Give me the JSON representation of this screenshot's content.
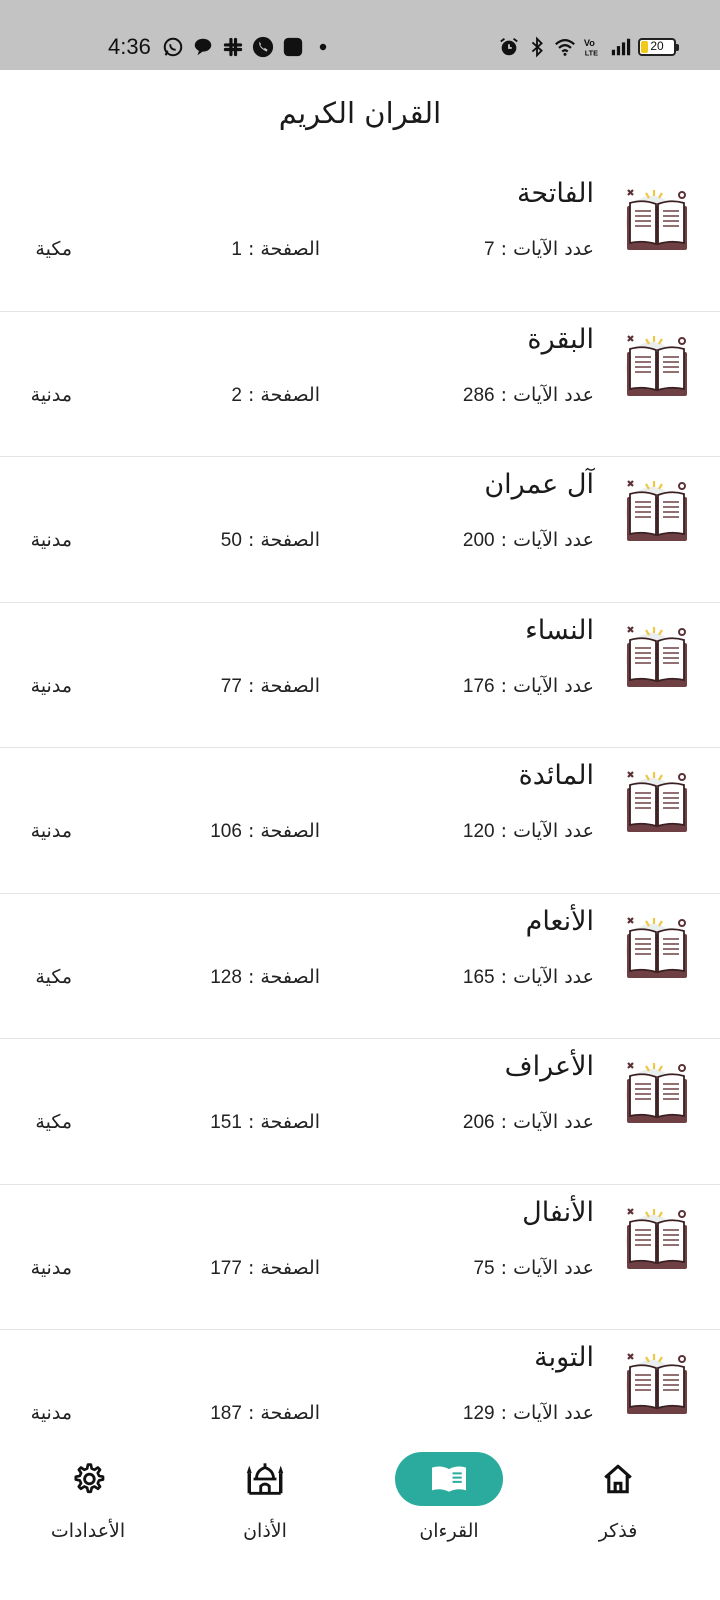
{
  "status_bar": {
    "time": "4:36",
    "battery_level": "20",
    "left_icons": [
      "whatsapp-icon",
      "chat-bubble-icon",
      "slack-icon",
      "phone-icon",
      "app-icon",
      "dot-icon"
    ],
    "right_icons": [
      "alarm-icon",
      "bluetooth-icon",
      "wifi-icon",
      "volte-icon",
      "signal-icon",
      "battery-icon"
    ]
  },
  "header": {
    "title": "القران الكريم"
  },
  "labels": {
    "ayahs_prefix": "عدد الآيات : ",
    "page_prefix": "الصفحة : "
  },
  "surahs": [
    {
      "name": "الفاتحة",
      "ayahs": "7",
      "page": "1",
      "type": "مكية"
    },
    {
      "name": "البقرة",
      "ayahs": "286",
      "page": "2",
      "type": "مدنية"
    },
    {
      "name": "آل عمران",
      "ayahs": "200",
      "page": "50",
      "type": "مدنية"
    },
    {
      "name": "النساء",
      "ayahs": "176",
      "page": "77",
      "type": "مدنية"
    },
    {
      "name": "المائدة",
      "ayahs": "120",
      "page": "106",
      "type": "مدنية"
    },
    {
      "name": "الأنعام",
      "ayahs": "165",
      "page": "128",
      "type": "مكية"
    },
    {
      "name": "الأعراف",
      "ayahs": "206",
      "page": "151",
      "type": "مكية"
    },
    {
      "name": "الأنفال",
      "ayahs": "75",
      "page": "177",
      "type": "مدنية"
    },
    {
      "name": "التوبة",
      "ayahs": "129",
      "page": "187",
      "type": "مدنية"
    }
  ],
  "bottom_nav": {
    "items": [
      {
        "label": "فذكر",
        "icon": "home-icon",
        "active": false
      },
      {
        "label": "القرءان",
        "icon": "book-icon",
        "active": true
      },
      {
        "label": "الأذان",
        "icon": "mosque-icon",
        "active": false
      },
      {
        "label": "الأعدادات",
        "icon": "gear-icon",
        "active": false
      }
    ]
  },
  "colors": {
    "accent": "#2aab9d",
    "status_bar": "#c3c3c3",
    "book_cover": "#6e4044",
    "divider": "#e4e4e4"
  }
}
